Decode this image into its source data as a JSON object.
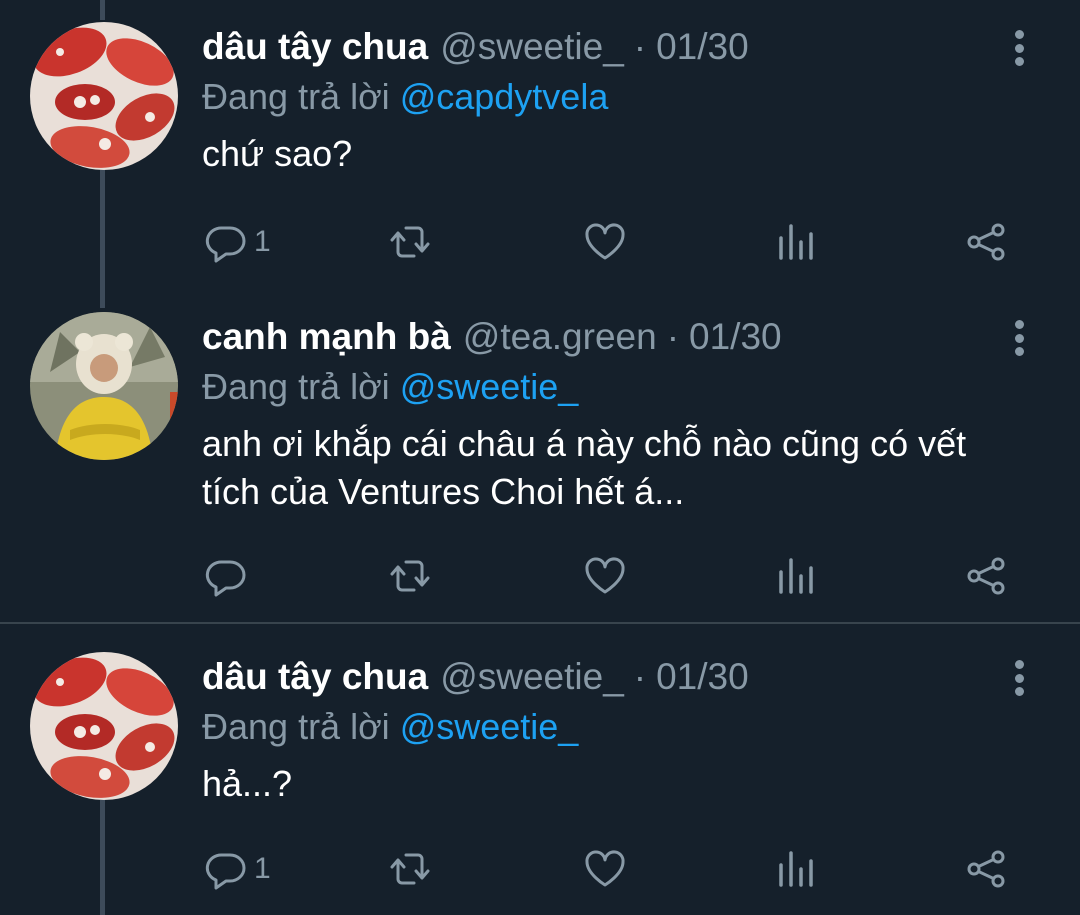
{
  "tweets": [
    {
      "name": "dâu tây chua",
      "handle": "@sweetie_",
      "dot": "·",
      "date": "01/30",
      "replying_prefix": "Đang trả lời",
      "replying_to": "@capdytvela",
      "text": "chứ sao?",
      "reply_count": "1",
      "avatar": "strawberry-avatar"
    },
    {
      "name": "canh mạnh bà",
      "handle": "@tea.green",
      "dot": "·",
      "date": "01/30",
      "replying_prefix": "Đang trả lời",
      "replying_to": "@sweetie_",
      "text": "anh ơi khắp cái châu á này chỗ nào cũng có vết tích của Ventures Choi hết á...",
      "reply_count": "",
      "avatar": "person-yellow-jacket-avatar"
    },
    {
      "name": "dâu tây chua",
      "handle": "@sweetie_",
      "dot": "·",
      "date": "01/30",
      "replying_prefix": "Đang trả lời",
      "replying_to": "@sweetie_",
      "text": "hả...?",
      "reply_count": "1",
      "avatar": "strawberry-avatar"
    }
  ],
  "icons": [
    "reply-icon",
    "retweet-icon",
    "like-icon",
    "analytics-icon",
    "share-icon",
    "more-options-icon"
  ],
  "colors": {
    "background": "#15202b",
    "text": "#ffffff",
    "secondary": "#8899a6",
    "mention": "#1da1f2",
    "thread_line": "#3d4b5a"
  }
}
